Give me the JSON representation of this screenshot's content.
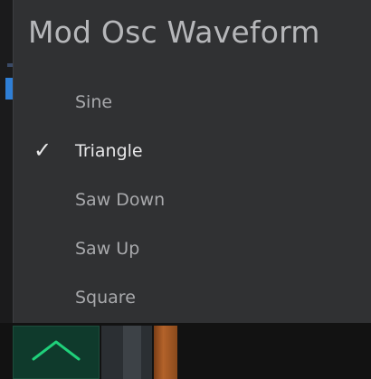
{
  "menu": {
    "title": "Mod Osc Waveform",
    "selected_check": "✓",
    "items": [
      {
        "label": "Sine",
        "selected": false
      },
      {
        "label": "Triangle",
        "selected": true
      },
      {
        "label": "Saw Down",
        "selected": false
      },
      {
        "label": "Saw Up",
        "selected": false
      },
      {
        "label": "Square",
        "selected": false
      }
    ]
  },
  "background": {
    "up_button_icon": "chevron-up-icon",
    "accent_color": "#1fd07a"
  }
}
